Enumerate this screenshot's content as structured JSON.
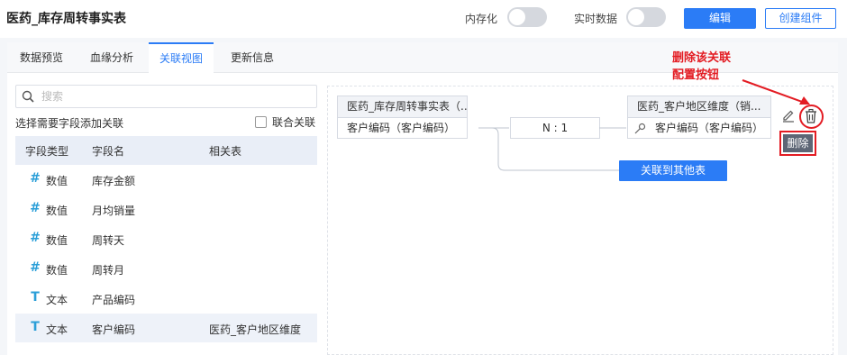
{
  "header": {
    "title": "医药_库存周转事实表",
    "toggle_memory_label": "内存化",
    "toggle_realtime_label": "实时数据",
    "edit_button": "编辑",
    "create_component_button": "创建组件"
  },
  "tabs": [
    {
      "label": "数据预览",
      "active": false
    },
    {
      "label": "血缘分析",
      "active": false
    },
    {
      "label": "关联视图",
      "active": true
    },
    {
      "label": "更新信息",
      "active": false
    }
  ],
  "left_panel": {
    "search_placeholder": "搜索",
    "hint": "选择需要字段添加关联",
    "joint_checkbox_label": "联合关联",
    "columns": [
      "字段类型",
      "字段名",
      "相关表"
    ],
    "rows": [
      {
        "type_icon": "#",
        "type": "数值",
        "field": "库存金额",
        "related": ""
      },
      {
        "type_icon": "#",
        "type": "数值",
        "field": "月均销量",
        "related": ""
      },
      {
        "type_icon": "#",
        "type": "数值",
        "field": "周转天",
        "related": ""
      },
      {
        "type_icon": "#",
        "type": "数值",
        "field": "周转月",
        "related": ""
      },
      {
        "type_icon": "T",
        "type": "文本",
        "field": "产品编码",
        "related": ""
      },
      {
        "type_icon": "T",
        "type": "文本",
        "field": "客户编码",
        "related": "医药_客户地区维度"
      }
    ]
  },
  "canvas": {
    "left_table": {
      "name": "医药_库存周转事实表（...",
      "field": "客户编码（客户编码）"
    },
    "join_type": "N : 1",
    "right_table": {
      "name": "医药_客户地区维度（销...",
      "field": "客户编码（客户编码）"
    },
    "link_other_button": "关联到其他表",
    "delete_button": "删除"
  },
  "annotation": {
    "line1": "删除该关联",
    "line2": "配置按钮"
  },
  "colors": {
    "accent": "#2b7cf6",
    "annotation_red": "#e31c23"
  }
}
